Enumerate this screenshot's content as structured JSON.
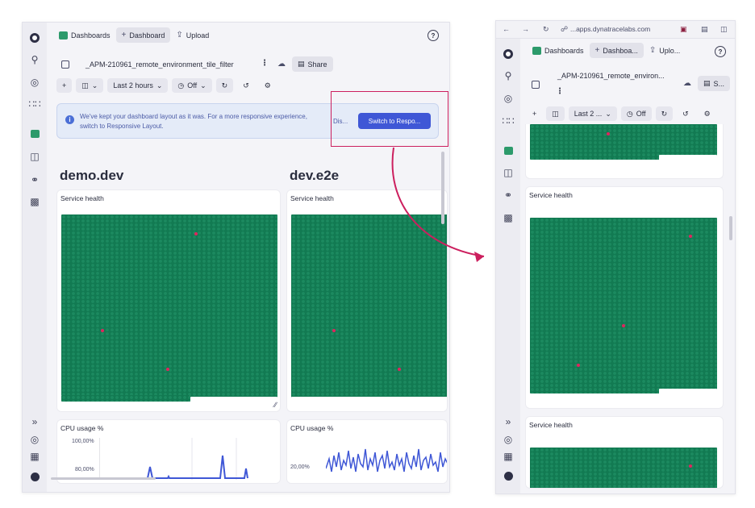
{
  "left": {
    "tabs": [
      {
        "label": "Dashboards",
        "icon": "dashboards-app-icon"
      },
      {
        "label": "Dashboard",
        "icon": "plus-icon"
      },
      {
        "label": "Upload",
        "icon": "upload-icon"
      }
    ],
    "title": "_APM-210961_remote_environment_tile_filter",
    "share_label": "Share",
    "toolbar": {
      "timeframe": "Last 2 hours",
      "refresh": "Off"
    },
    "banner": {
      "text": "We've kept your dashboard layout as it was. For a more responsive experience, switch to Responsive Layout.",
      "dismiss": "Dis...",
      "switch": "Switch to Respo..."
    },
    "envs": [
      "demo.dev",
      "dev.e2e"
    ],
    "tile_service": "Service health",
    "tile_cpu": "CPU usage %",
    "cpu_axis_left": [
      "100,00%",
      "80,00%"
    ],
    "cpu_axis_right": [
      "20,00%"
    ]
  },
  "right": {
    "url": "...apps.dynatracelabs.com",
    "tabs": [
      {
        "label": "Dashboards",
        "icon": "dashboards-app-icon"
      },
      {
        "label": "Dashboa...",
        "icon": "plus-icon"
      },
      {
        "label": "Uplo...",
        "icon": "upload-icon"
      }
    ],
    "title": "_APM-210961_remote_environ...",
    "share_label": "S...",
    "toolbar": {
      "timeframe": "Last 2 ...",
      "refresh": "Off"
    },
    "tile_service": "Service health"
  },
  "colors": {
    "hex_green": "#127a52",
    "alert_red": "#e0245e",
    "accent_blue": "#3f57d6",
    "annotation": "#cc1f5e"
  }
}
